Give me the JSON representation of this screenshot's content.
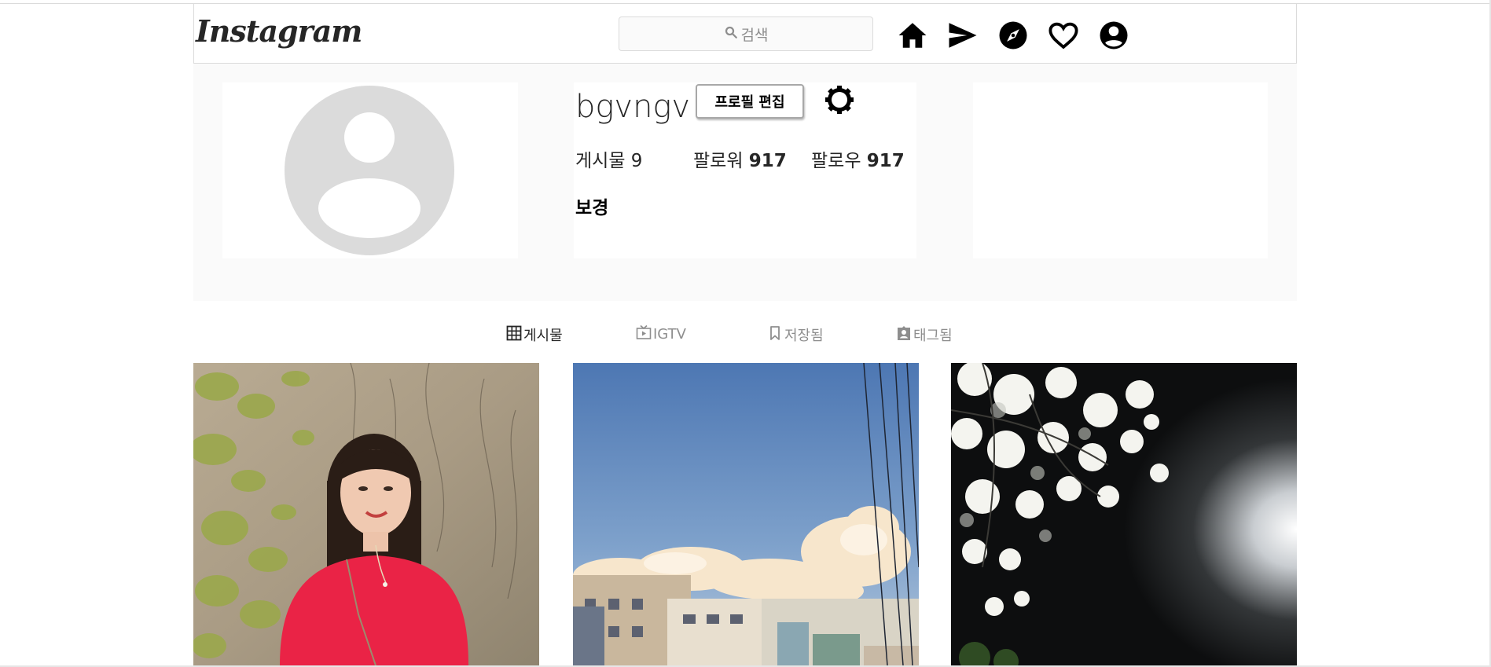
{
  "header": {
    "logo": "Instagram",
    "search_placeholder": "검색",
    "nav_icons": [
      "home-icon",
      "direct-message-icon",
      "explore-icon",
      "activity-heart-icon",
      "profile-icon"
    ]
  },
  "profile": {
    "username": "bgvngv",
    "edit_button": "프로필 편집",
    "posts_label": "게시물",
    "posts_count": "9",
    "followers_label": "팔로워",
    "followers_count": "917",
    "following_label": "팔로우",
    "following_count": "917",
    "full_name": "보경"
  },
  "tabs": [
    {
      "label": "게시물",
      "icon": "grid-icon",
      "active": true
    },
    {
      "label": "IGTV",
      "icon": "tv-icon",
      "active": false
    },
    {
      "label": "저장됨",
      "icon": "bookmark-icon",
      "active": false
    },
    {
      "label": "태그됨",
      "icon": "tagged-user-icon",
      "active": false
    }
  ],
  "posts": [
    {
      "alt": "woman in red sweater smiling in front of ivy wall"
    },
    {
      "alt": "blue sky with clouds over buildings and power lines"
    },
    {
      "alt": "white cherry blossoms at night"
    }
  ],
  "colors": {
    "border": "#dbdbdb",
    "panel_bg": "#fafafa",
    "muted_text": "#8e8e8e",
    "avatar_gray": "#dbdbdb"
  }
}
